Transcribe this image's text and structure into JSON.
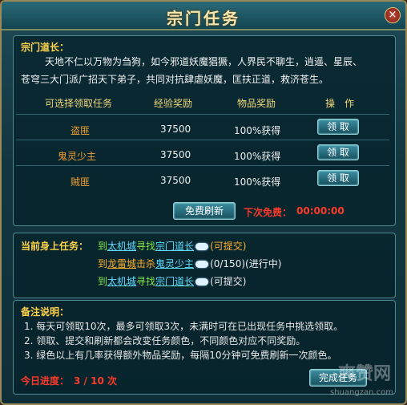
{
  "window": {
    "title": "宗门任务",
    "close_label": "×"
  },
  "intro": {
    "heading": "宗门道长：",
    "line1": "天地不仁以万物为刍狗，如今邪道妖魔猖獗，人界民不聊生，逍遥、星辰、",
    "line2": "苍穹三大门派广招天下弟子，共同对抗肆虐妖魔，匡扶正道，救济苍生。"
  },
  "table": {
    "headers": [
      "可选择领取任务",
      "经验奖励",
      "物品奖励",
      "操　作"
    ],
    "rows": [
      {
        "name": "盗匪",
        "exp": "37500",
        "item": "100%获得",
        "action": "领 取"
      },
      {
        "name": "鬼灵少主",
        "exp": "37500",
        "item": "100%获得",
        "action": "领 取"
      },
      {
        "name": "贼匪",
        "exp": "37500",
        "item": "100%获得",
        "action": "领 取"
      }
    ]
  },
  "refresh": {
    "button": "免费刷新",
    "next_label": "下次免费：",
    "next_time": "00:00:00"
  },
  "current": {
    "heading": "当前身上任务：",
    "lines": [
      {
        "pre": "到",
        "place": "太机城",
        "verb": "寻找",
        "target": "宗门道长",
        "status": "(可提交)"
      },
      {
        "pre": "到",
        "place": "龙雷城",
        "verb": "击杀",
        "target": "鬼灵少主",
        "status": "(0/150)(进行中)"
      },
      {
        "pre": "到",
        "place": "太机城",
        "verb": "寻找",
        "target": "宗门道长",
        "status": "(可提交)"
      }
    ]
  },
  "notes": {
    "heading": "备注说明：",
    "items": [
      "1. 每天可领取10次，最多可领取3次，未满时可在已出现任务中挑选领取。",
      "2. 领取、提交和刷新都会改变任务颜色，不同颜色对应不同奖励。",
      "3. 绿色以上有几率获得额外物品奖励，每隔10分钟可免费刷新一次颜色。"
    ]
  },
  "progress": {
    "label": "今日进度：",
    "value": "3 / 10 次"
  },
  "footer": {
    "button": "完成任务"
  },
  "watermark": {
    "text": "爽赞网",
    "url": "shuangzan.com"
  }
}
